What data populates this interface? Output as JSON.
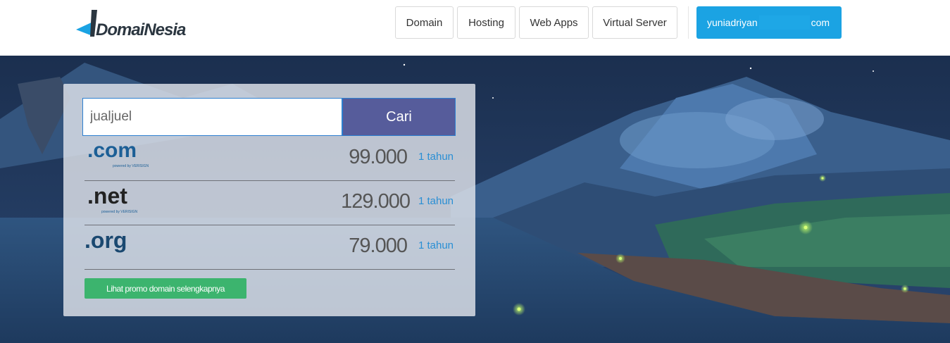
{
  "header": {
    "logo_text": "DomaiNesia",
    "nav": [
      {
        "label": "Domain"
      },
      {
        "label": "Hosting"
      },
      {
        "label": "Web Apps"
      },
      {
        "label": "Virtual Server"
      }
    ],
    "account": {
      "prefix": "yuniadriyan",
      "suffix": "com"
    }
  },
  "search": {
    "value": "jualjuel",
    "button_label": "Cari"
  },
  "domains": [
    {
      "tld": ".com",
      "price": "99.000",
      "period": "1 tahun",
      "powered": "powered by VERISIGN"
    },
    {
      "tld": ".net",
      "price": "129.000",
      "period": "1 tahun",
      "powered": "powered by VERISIGN"
    },
    {
      "tld": ".org",
      "price": "79.000",
      "period": "1 tahun"
    }
  ],
  "promo_label": "Lihat promo domain selengkapnya",
  "colors": {
    "accent": "#1ba3e3",
    "search_button": "#565c9b",
    "promo": "#3cb46e",
    "hero_sky": "#1e3557"
  }
}
